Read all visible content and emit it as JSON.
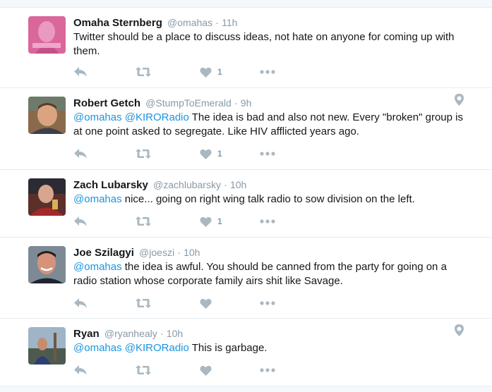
{
  "colors": {
    "icon": "#aab8c2",
    "link": "#1b95e0",
    "muted": "#8899a6"
  },
  "tweets": [
    {
      "name": "Omaha Sternberg",
      "handle": "@omahas",
      "dot": "·",
      "time": "11h",
      "mentions": "",
      "text": "Twitter should be a place to discuss ideas, not hate on anyone for coming up with them.",
      "likes": "1",
      "has_location": false,
      "avatar_icon": "avatar-pink-portrait"
    },
    {
      "name": "Robert Getch",
      "handle": "@StumpToEmerald",
      "dot": "·",
      "time": "9h",
      "mentions": "@omahas @KIRORadio",
      "text": " The idea is bad and also not new. Every \"broken\" group is at one point asked to segregate. Like HIV afflicted years ago.",
      "likes": "1",
      "has_location": true,
      "avatar_icon": "avatar-photo"
    },
    {
      "name": "Zach Lubarsky",
      "handle": "@zachlubarsky",
      "dot": "·",
      "time": "10h",
      "mentions": "@omahas",
      "text": " nice... going on right wing talk radio to sow division on the left.",
      "likes": "1",
      "has_location": false,
      "avatar_icon": "avatar-photo"
    },
    {
      "name": "Joe Szilagyi",
      "handle": "@joeszi",
      "dot": "·",
      "time": "10h",
      "mentions": "@omahas",
      "text": " the idea is awful. You should be canned from the party for going on a radio station whose corporate family airs shit like Savage.",
      "likes": "",
      "has_location": false,
      "avatar_icon": "avatar-photo"
    },
    {
      "name": "Ryan",
      "handle": "@ryanhealy",
      "dot": "·",
      "time": "10h",
      "mentions": "@omahas @KIRORadio",
      "text": " This is garbage.",
      "likes": "",
      "has_location": true,
      "avatar_icon": "avatar-photo"
    }
  ]
}
